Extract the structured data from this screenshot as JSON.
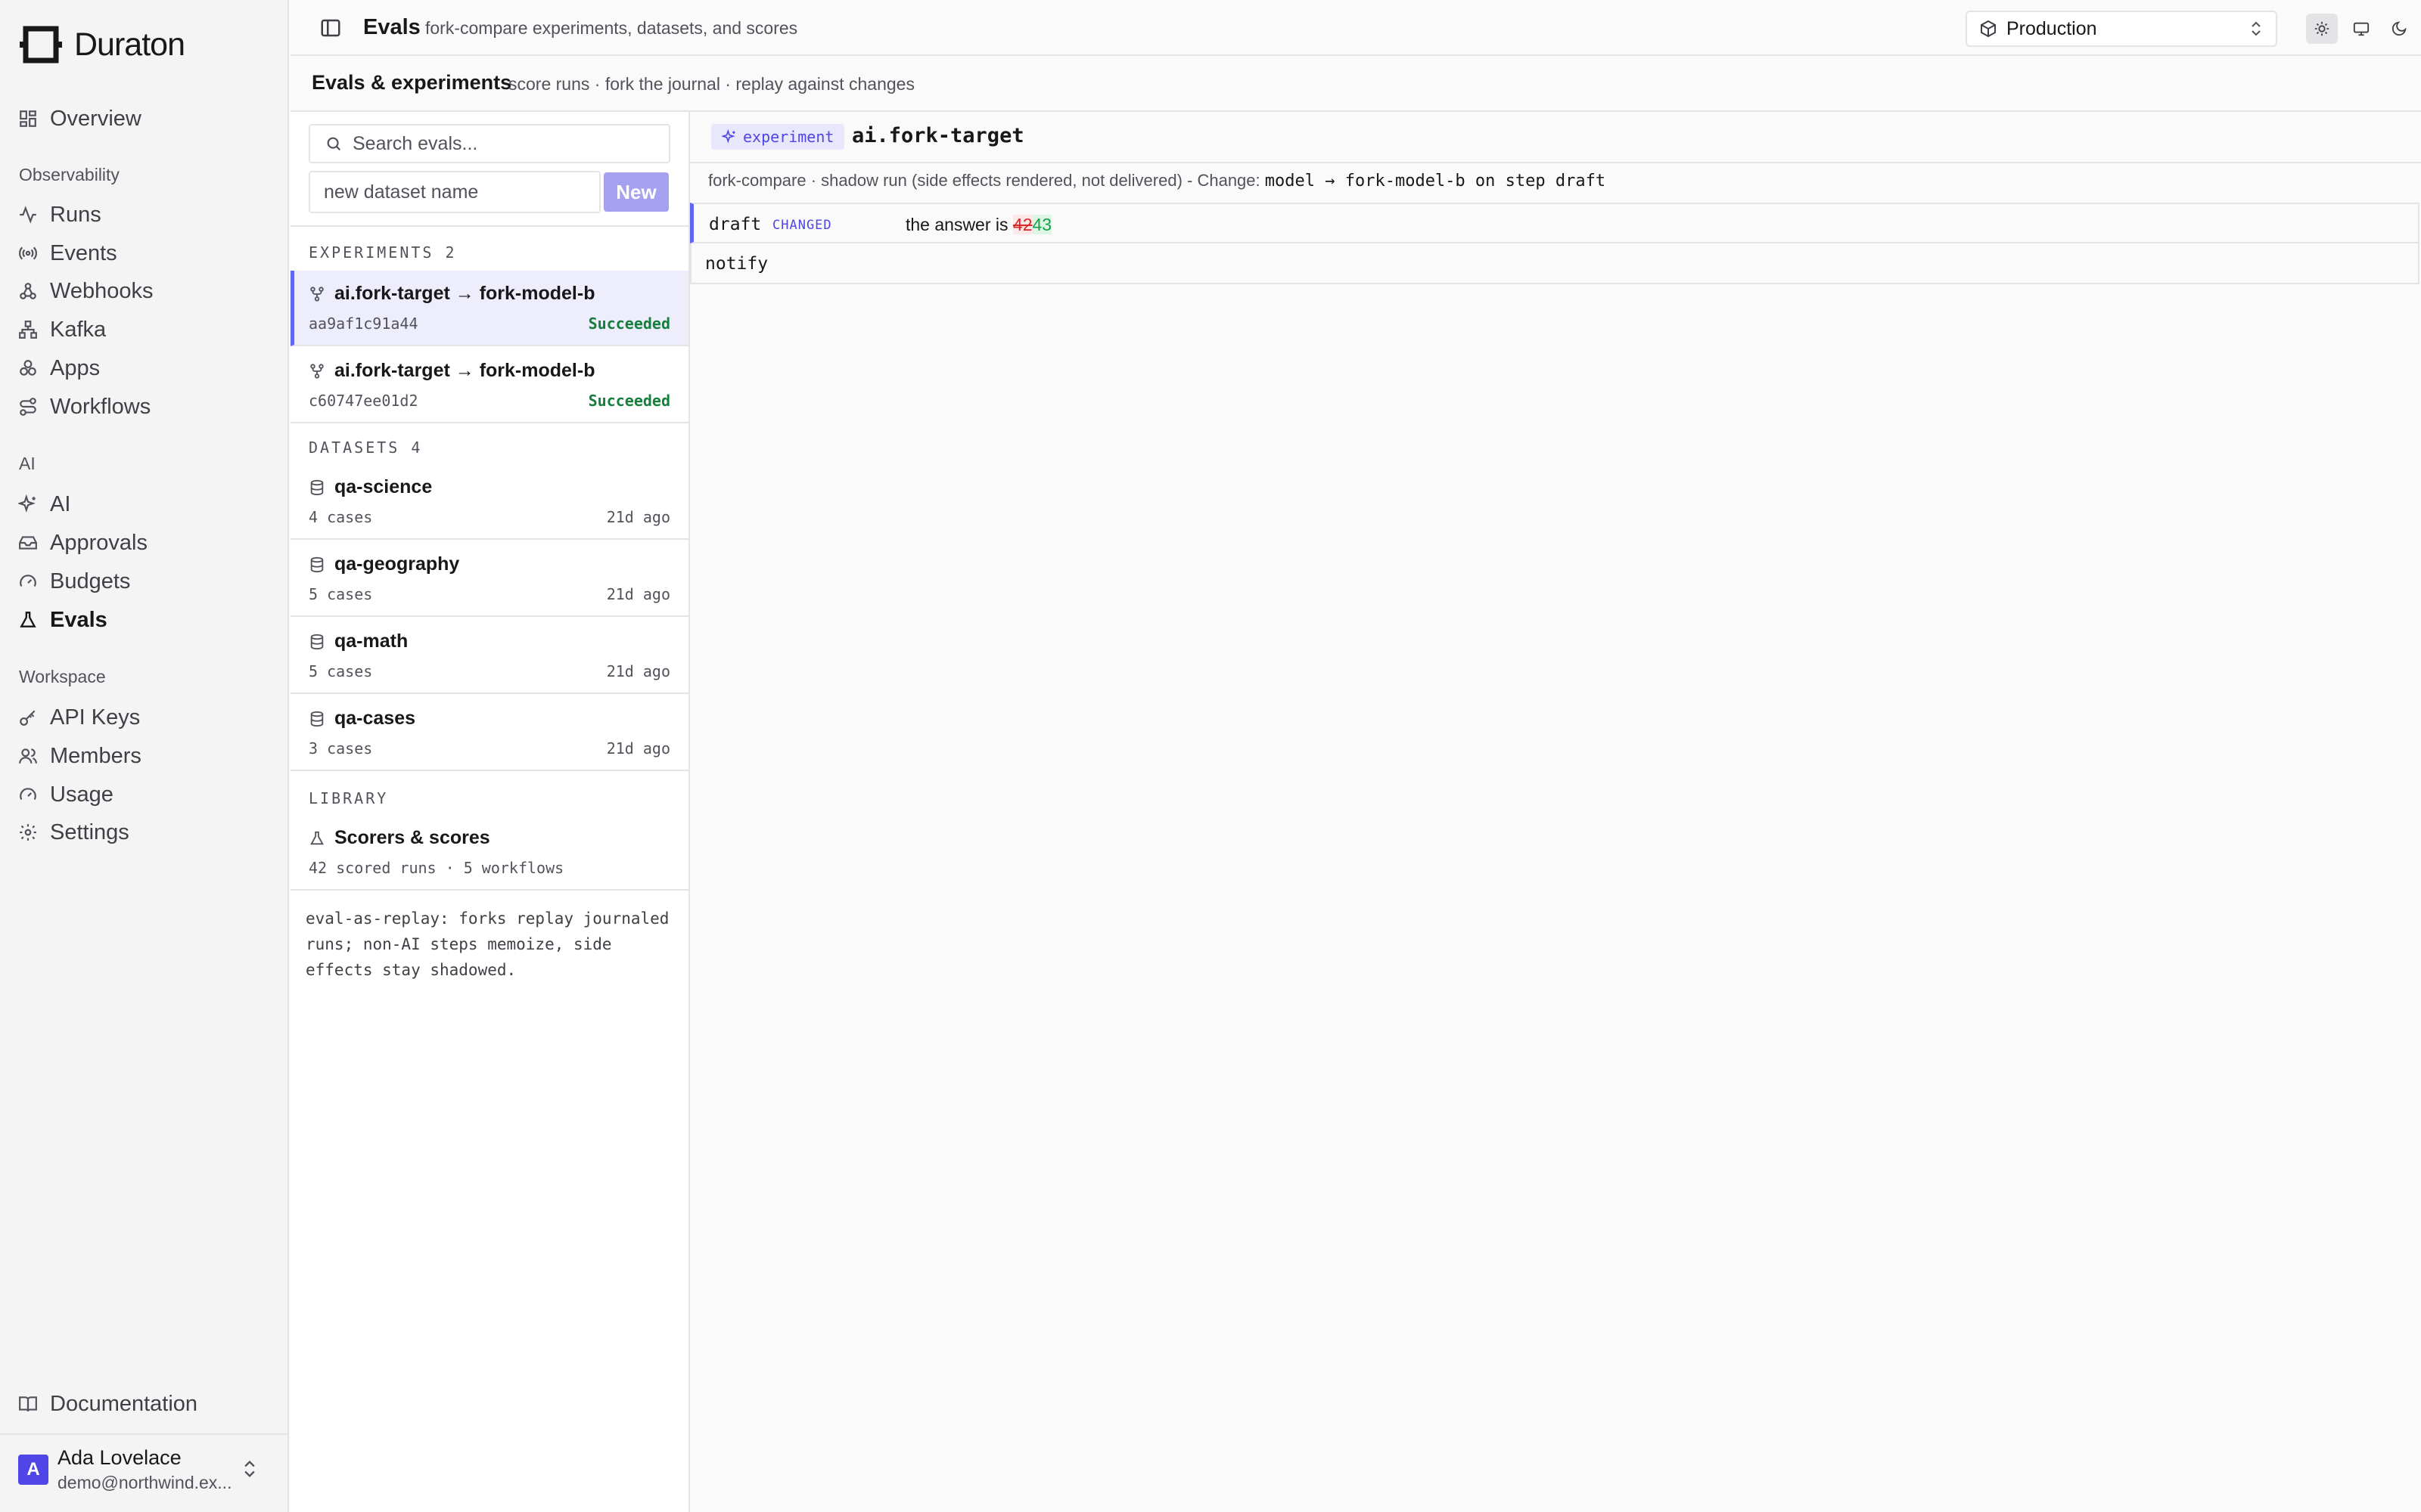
{
  "app": {
    "name": "Duraton"
  },
  "sidebar": {
    "overview": "Overview",
    "sections": {
      "observability": "Observability",
      "ai": "AI",
      "workspace": "Workspace"
    },
    "observability_items": [
      "Runs",
      "Events",
      "Webhooks",
      "Kafka",
      "Apps",
      "Workflows"
    ],
    "ai_items": [
      "AI",
      "Approvals",
      "Budgets",
      "Evals"
    ],
    "workspace_items": [
      "API Keys",
      "Members",
      "Usage",
      "Settings"
    ],
    "active": "Evals",
    "documentation": "Documentation"
  },
  "user": {
    "initial": "A",
    "name": "Ada Lovelace",
    "email": "demo@northwind.ex..."
  },
  "topbar": {
    "title": "Evals",
    "description": "fork-compare experiments, datasets, and scores",
    "environment": "Production"
  },
  "subheader": {
    "title": "Evals & experiments",
    "description": "score runs · fork the journal · replay against changes"
  },
  "list": {
    "search_placeholder": "Search evals...",
    "dataset_placeholder": "new dataset name",
    "new_button": "New",
    "experiments_label": "EXPERIMENTS 2",
    "experiments": [
      {
        "title": "ai.fork-target → fork-model-b",
        "id": "aa9af1c91a44",
        "status": "Succeeded"
      },
      {
        "title": "ai.fork-target → fork-model-b",
        "id": "c60747ee01d2",
        "status": "Succeeded"
      }
    ],
    "datasets_label": "DATASETS 4",
    "datasets": [
      {
        "name": "qa-science",
        "cases": "4 cases",
        "age": "21d ago"
      },
      {
        "name": "qa-geography",
        "cases": "5 cases",
        "age": "21d ago"
      },
      {
        "name": "qa-math",
        "cases": "5 cases",
        "age": "21d ago"
      },
      {
        "name": "qa-cases",
        "cases": "3 cases",
        "age": "21d ago"
      }
    ],
    "library_label": "LIBRARY",
    "library": {
      "title": "Scorers & scores",
      "sub": "42 scored runs · 5 workflows"
    },
    "note": "eval-as-replay: forks replay journaled runs; non-AI steps memoize, side effects stay shadowed."
  },
  "detail": {
    "badge": "experiment",
    "name": "ai.fork-target",
    "meta_prefix": "fork-compare · shadow run (side effects rendered, not delivered) - Change:",
    "change": "model → fork-model-b on step draft",
    "steps": [
      {
        "name": "draft",
        "tag": "CHANGED",
        "diff_prefix": "the answer is ",
        "old": "42",
        "new": "43"
      },
      {
        "name": "notify"
      }
    ]
  },
  "colors": {
    "accent": "#6366f1",
    "success": "#15803d",
    "deleted": "#dc2626",
    "inserted": "#16a34a"
  }
}
